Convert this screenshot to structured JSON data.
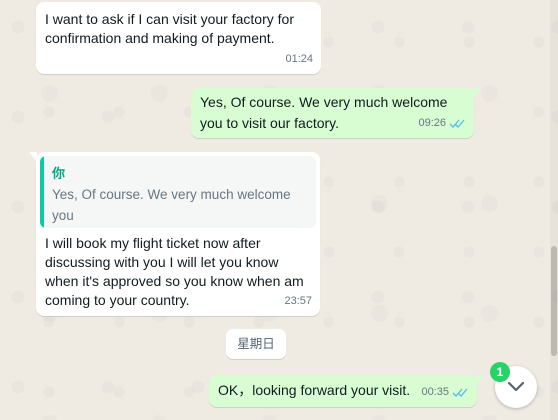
{
  "chat": {
    "messages": [
      {
        "direction": "incoming",
        "text": "I want to ask if I can visit your factory for\nconfirmation and making of payment.",
        "time": "01:24"
      },
      {
        "direction": "outgoing",
        "text": "Yes, Of course. We very much welcome\nyou to visit our factory.",
        "time": "09:26",
        "status": "read"
      },
      {
        "direction": "incoming",
        "quote": {
          "author": "你",
          "text": "Yes, Of course. We very much welcome you\nto visit our factory."
        },
        "text": "I will book my flight ticket now after\ndiscussing with you I will let you know\nwhen it's approved so you know when am\ncoming to your country.",
        "time": "23:57"
      },
      {
        "direction": "outgoing",
        "text": "OK，looking forward your visit.",
        "time": "00:35",
        "status": "read"
      }
    ],
    "date_separator": "星期日",
    "unread_count": "1",
    "scroll_button_icon": "chevron-down-icon"
  },
  "colors": {
    "background": "#efeae2",
    "incoming_bubble": "#ffffff",
    "outgoing_bubble": "#d9fdd3",
    "read_ticks": "#53bdeb",
    "quote_accent": "#06cf9c",
    "badge": "#25d366"
  }
}
